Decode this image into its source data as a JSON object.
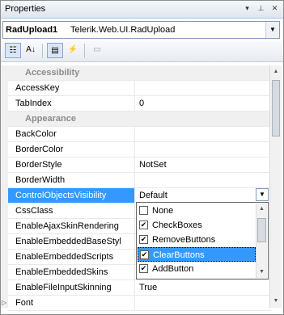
{
  "window": {
    "title": "Properties"
  },
  "object_selector": {
    "name": "RadUpload1",
    "type": "Telerik.Web.UI.RadUpload"
  },
  "toolbar": {
    "categorized_icon": "categorized-icon",
    "alphabetical_icon": "alphabetical-icon",
    "properties_icon": "properties-icon",
    "events_icon": "lightning-icon",
    "property_pages_icon": "property-pages-icon"
  },
  "rows": [
    {
      "type": "category",
      "name": "Accessibility"
    },
    {
      "type": "prop",
      "name": "AccessKey",
      "value": ""
    },
    {
      "type": "prop",
      "name": "TabIndex",
      "value": "0"
    },
    {
      "type": "category",
      "name": "Appearance"
    },
    {
      "type": "prop",
      "name": "BackColor",
      "value": ""
    },
    {
      "type": "prop",
      "name": "BorderColor",
      "value": ""
    },
    {
      "type": "prop",
      "name": "BorderStyle",
      "value": "NotSet"
    },
    {
      "type": "prop",
      "name": "BorderWidth",
      "value": ""
    },
    {
      "type": "prop",
      "name": "ControlObjectsVisibility",
      "value": "Default",
      "selected": true
    },
    {
      "type": "prop",
      "name": "CssClass",
      "value": ""
    },
    {
      "type": "prop",
      "name": "EnableAjaxSkinRendering",
      "value": ""
    },
    {
      "type": "prop",
      "name": "EnableEmbeddedBaseStyl",
      "value": ""
    },
    {
      "type": "prop",
      "name": "EnableEmbeddedScripts",
      "value": ""
    },
    {
      "type": "prop",
      "name": "EnableEmbeddedSkins",
      "value": ""
    },
    {
      "type": "prop",
      "name": "EnableFileInputSkinning",
      "value": "True"
    },
    {
      "type": "collapsed",
      "name": "Font",
      "value": ""
    }
  ],
  "dropdown": {
    "options": [
      {
        "label": "None",
        "checked": false
      },
      {
        "label": "CheckBoxes",
        "checked": true
      },
      {
        "label": "RemoveButtons",
        "checked": true
      },
      {
        "label": "ClearButtons",
        "checked": true,
        "selected": true
      },
      {
        "label": "AddButton",
        "checked": true
      }
    ]
  },
  "colors": {
    "selection": "#3399ff",
    "category_bg": "#f0f0f0",
    "category_text": "#8c8c8c"
  }
}
